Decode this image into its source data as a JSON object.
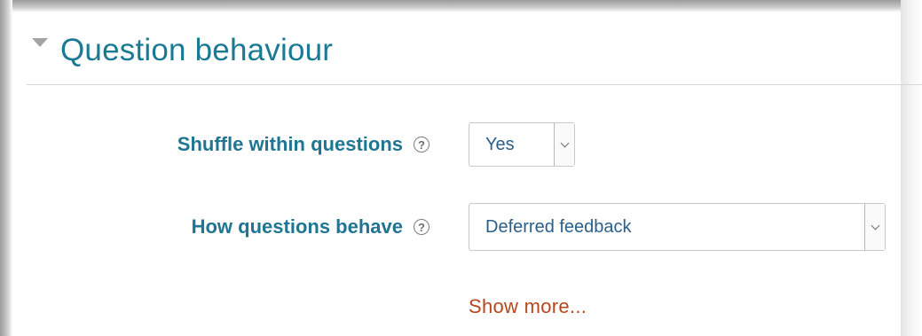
{
  "section": {
    "title": "Question behaviour",
    "collapse_icon": "triangle-down-icon"
  },
  "fields": [
    {
      "label": "Shuffle within questions",
      "help_icon": "question-circle-icon",
      "help_glyph": "?",
      "value": "Yes"
    },
    {
      "label": "How questions behave",
      "help_icon": "question-circle-icon",
      "help_glyph": "?",
      "value": "Deferred feedback"
    }
  ],
  "show_more_label": "Show more...",
  "colors": {
    "title": "#1b7a93",
    "label": "#1f7592",
    "select_text": "#2a5f8a",
    "link": "#b8451c"
  }
}
